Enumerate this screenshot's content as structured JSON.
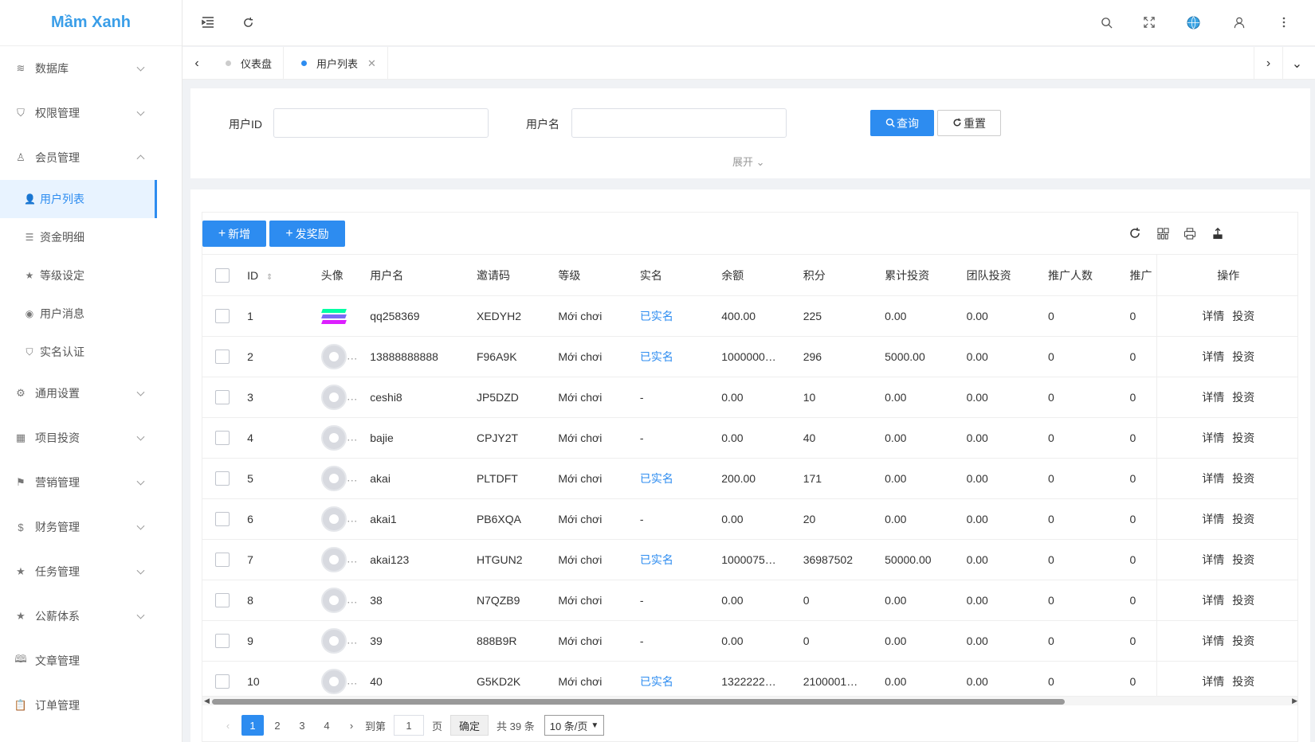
{
  "app": {
    "logo": "Mầm Xanh"
  },
  "sidebar": {
    "items": [
      {
        "label": "数据库",
        "icon": "layers-icon",
        "glyph": "≋"
      },
      {
        "label": "权限管理",
        "icon": "shield-check-icon",
        "glyph": "⛉"
      },
      {
        "label": "会员管理",
        "icon": "user-icon",
        "glyph": "♙"
      }
    ],
    "sub_items": [
      {
        "label": "用户列表",
        "icon": "user-filled-icon",
        "glyph": "👤",
        "active": true
      },
      {
        "label": "资金明细",
        "icon": "list-icon",
        "glyph": "☰"
      },
      {
        "label": "等级设定",
        "icon": "star-icon",
        "glyph": "★"
      },
      {
        "label": "用户消息",
        "icon": "message-icon",
        "glyph": "◉"
      },
      {
        "label": "实名认证",
        "icon": "shield-icon",
        "glyph": "⛉"
      }
    ],
    "items_after": [
      {
        "label": "通用设置",
        "icon": "gear-icon",
        "glyph": "⚙"
      },
      {
        "label": "项目投资",
        "icon": "apps-icon",
        "glyph": "▦"
      },
      {
        "label": "营销管理",
        "icon": "flag-icon",
        "glyph": "⚑"
      },
      {
        "label": "财务管理",
        "icon": "dollar-icon",
        "glyph": "$"
      },
      {
        "label": "任务管理",
        "icon": "star-icon",
        "glyph": "★"
      },
      {
        "label": "公薪体系",
        "icon": "star-icon",
        "glyph": "★"
      },
      {
        "label": "文章管理",
        "icon": "book-icon",
        "glyph": "🕮"
      },
      {
        "label": "订单管理",
        "icon": "clipboard-icon",
        "glyph": "📋"
      }
    ]
  },
  "header": {
    "icons": [
      "menu-fold-icon",
      "refresh-icon",
      "search-icon",
      "fullscreen-icon",
      "globe-icon",
      "user-icon",
      "more-vertical-icon"
    ]
  },
  "tabs": [
    {
      "label": "仪表盘",
      "active": false
    },
    {
      "label": "用户列表",
      "active": true
    }
  ],
  "search": {
    "user_id_label": "用户ID",
    "username_label": "用户名",
    "query_button": "查询",
    "reset_button": "重置",
    "expand": "展开"
  },
  "toolbar": {
    "add_button": "新增",
    "reward_button": "发奖励"
  },
  "table": {
    "columns": [
      "ID",
      "头像",
      "用户名",
      "邀请码",
      "等级",
      "实名",
      "余额",
      "积分",
      "累计投资",
      "团队投资",
      "推广人数",
      "推广",
      "操作"
    ],
    "rows": [
      {
        "id": "1",
        "avatar": "solana",
        "username": "qq258369",
        "invite": "XEDYH2",
        "level": "Mới chơi",
        "realname": "已实名",
        "balance": "400.00",
        "points": "225",
        "total_invest": "0.00",
        "team_invest": "0.00",
        "promo_count": "0",
        "promo": "0"
      },
      {
        "id": "2",
        "avatar": "default",
        "username": "13888888888",
        "invite": "F96A9K",
        "level": "Mới chơi",
        "realname": "已实名",
        "balance": "1000000…",
        "points": "296",
        "total_invest": "5000.00",
        "team_invest": "0.00",
        "promo_count": "0",
        "promo": "0"
      },
      {
        "id": "3",
        "avatar": "default",
        "username": "ceshi8",
        "invite": "JP5DZD",
        "level": "Mới chơi",
        "realname": "-",
        "balance": "0.00",
        "points": "10",
        "total_invest": "0.00",
        "team_invest": "0.00",
        "promo_count": "0",
        "promo": "0"
      },
      {
        "id": "4",
        "avatar": "default",
        "username": "bajie",
        "invite": "CPJY2T",
        "level": "Mới chơi",
        "realname": "-",
        "balance": "0.00",
        "points": "40",
        "total_invest": "0.00",
        "team_invest": "0.00",
        "promo_count": "0",
        "promo": "0"
      },
      {
        "id": "5",
        "avatar": "default",
        "username": "akai",
        "invite": "PLTDFT",
        "level": "Mới chơi",
        "realname": "已实名",
        "balance": "200.00",
        "points": "171",
        "total_invest": "0.00",
        "team_invest": "0.00",
        "promo_count": "0",
        "promo": "0"
      },
      {
        "id": "6",
        "avatar": "default",
        "username": "akai1",
        "invite": "PB6XQA",
        "level": "Mới chơi",
        "realname": "-",
        "balance": "0.00",
        "points": "20",
        "total_invest": "0.00",
        "team_invest": "0.00",
        "promo_count": "0",
        "promo": "0"
      },
      {
        "id": "7",
        "avatar": "default",
        "username": "akai123",
        "invite": "HTGUN2",
        "level": "Mới chơi",
        "realname": "已实名",
        "balance": "1000075…",
        "points": "36987502",
        "total_invest": "50000.00",
        "team_invest": "0.00",
        "promo_count": "0",
        "promo": "0"
      },
      {
        "id": "8",
        "avatar": "default",
        "username": "38",
        "invite": "N7QZB9",
        "level": "Mới chơi",
        "realname": "-",
        "balance": "0.00",
        "points": "0",
        "total_invest": "0.00",
        "team_invest": "0.00",
        "promo_count": "0",
        "promo": "0"
      },
      {
        "id": "9",
        "avatar": "default",
        "username": "39",
        "invite": "888B9R",
        "level": "Mới chơi",
        "realname": "-",
        "balance": "0.00",
        "points": "0",
        "total_invest": "0.00",
        "team_invest": "0.00",
        "promo_count": "0",
        "promo": "0"
      },
      {
        "id": "10",
        "avatar": "default",
        "username": "40",
        "invite": "G5KD2K",
        "level": "Mới chơi",
        "realname": "已实名",
        "balance": "1322222…",
        "points": "2100001…",
        "total_invest": "0.00",
        "team_invest": "0.00",
        "promo_count": "0",
        "promo": "0"
      }
    ],
    "actions": [
      "详情",
      "投资"
    ]
  },
  "pagination": {
    "pages": [
      "1",
      "2",
      "3",
      "4"
    ],
    "current": "1",
    "goto_label": "到第",
    "goto_value": "1",
    "page_suffix": "页",
    "confirm": "确定",
    "total": "共 39 条",
    "page_size": "10 条/页"
  },
  "colors": {
    "primary": "#2d8cf0",
    "logo": "#3a9ee8",
    "link": "#2d8cf0"
  }
}
